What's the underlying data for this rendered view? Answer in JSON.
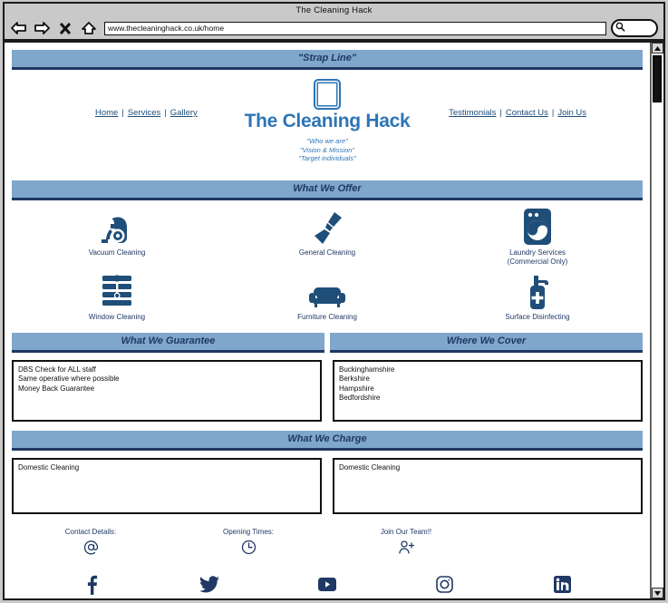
{
  "browser": {
    "window_title": "The Cleaning Hack",
    "url": "www.thecleaninghack.co.uk/home",
    "toolbar": [
      {
        "name": "back-arrow-icon",
        "label": "Back"
      },
      {
        "name": "forward-arrow-icon",
        "label": "Forward"
      },
      {
        "name": "close-icon",
        "label": "Stop"
      },
      {
        "name": "home-icon",
        "label": "Home"
      }
    ],
    "search_icon": "search-icon"
  },
  "strap": {
    "title": "\"Strap Line\""
  },
  "header": {
    "nav_left": [
      "Home",
      "Services",
      "Gallery"
    ],
    "nav_right": [
      "Testimonials",
      "Contact Us",
      "Join Us"
    ],
    "brand": "The Cleaning Hack",
    "logo_icon": "logo-square-icon",
    "tagline": [
      "\"Who we are\"",
      "\"Vision & Mission\"",
      "\"Target individuals\""
    ],
    "separator": "|"
  },
  "offers": {
    "title": "What We Offer",
    "items": [
      {
        "label": "Vacuum Cleaning",
        "icon": "vacuum-icon"
      },
      {
        "label": "General Cleaning",
        "icon": "brush-icon"
      },
      {
        "label": "Laundry Services\n(Commercial Only)",
        "icon": "washing-machine-icon"
      },
      {
        "label": "Window Cleaning",
        "icon": "blinds-icon"
      },
      {
        "label": "Furniture Cleaning",
        "icon": "sofa-icon"
      },
      {
        "label": "Surface Disinfecting",
        "icon": "spray-bottle-icon"
      }
    ]
  },
  "guarantee": {
    "title": "What We Guarantee",
    "items": "DBS Check for ALL staff\nSame operative where possible\nMoney Back Guarantee"
  },
  "cover": {
    "title": "Where We Cover",
    "items": "Buckinghamshire\nBerkshire\nHampshire\nBedfordshire"
  },
  "charge": {
    "title": "What We Charge",
    "left": "Domestic Cleaning",
    "right": "Domestic Cleaning"
  },
  "footer": {
    "columns": [
      {
        "label": "Contact Details:",
        "icon": "at-sign-icon"
      },
      {
        "label": "Opening Times:",
        "icon": "clock-icon"
      },
      {
        "label": "Join Our Team!!",
        "icon": "add-person-icon"
      }
    ],
    "social": [
      {
        "name": "facebook-icon"
      },
      {
        "name": "twitter-icon"
      },
      {
        "name": "youtube-icon"
      },
      {
        "name": "instagram-icon"
      },
      {
        "name": "linkedin-icon"
      }
    ]
  },
  "colors": {
    "band": "#7fa7cb",
    "band_border": "#1f3864",
    "brand": "#2e75b6",
    "icon": "#1f4e79",
    "text": "#1f3864"
  }
}
